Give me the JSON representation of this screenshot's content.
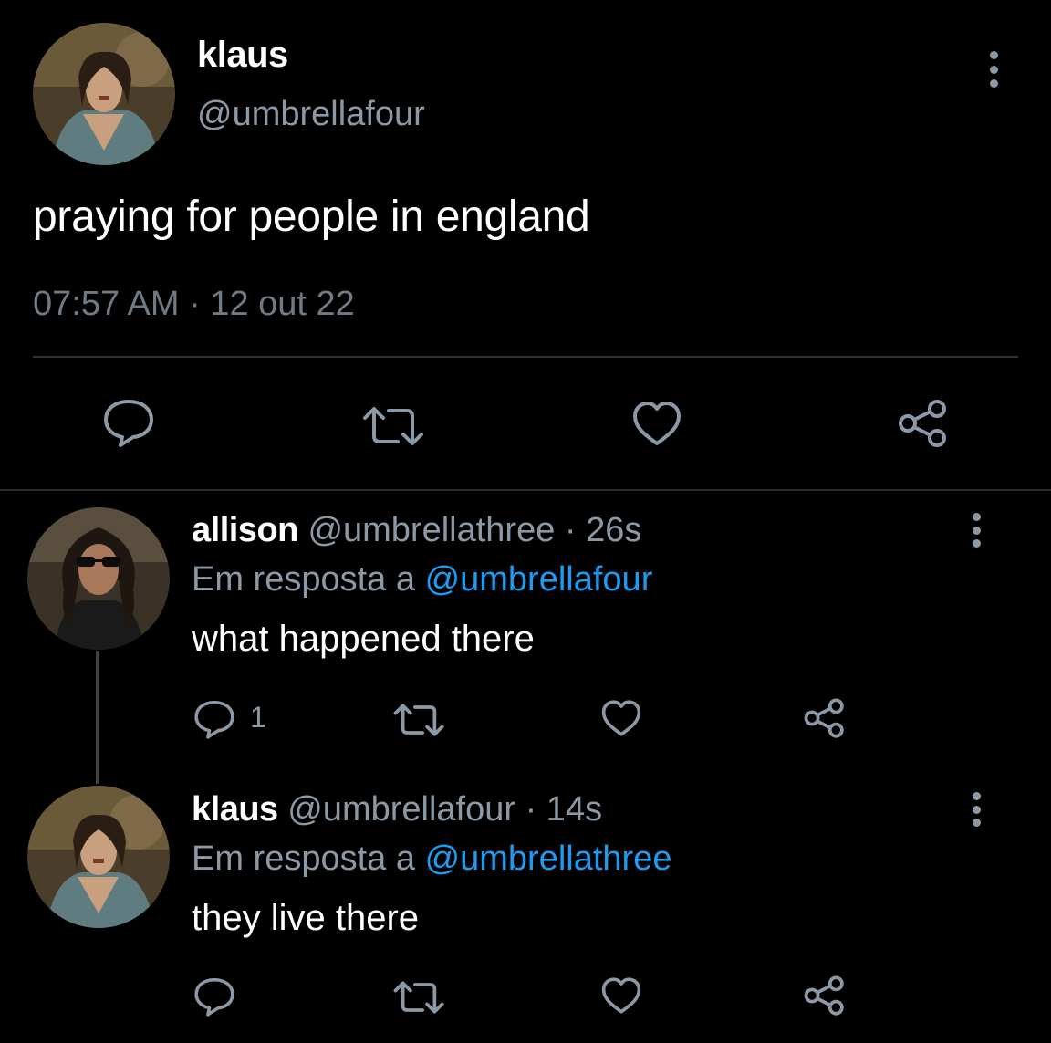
{
  "main_tweet": {
    "name": "klaus",
    "handle": "@umbrellafour",
    "text": "praying for people in england",
    "timestamp": "07:57 AM · 12 out 22",
    "more_icon": "more-vertical-icon",
    "actions": [
      "reply-icon",
      "retweet-icon",
      "like-icon",
      "share-icon"
    ]
  },
  "replies": [
    {
      "name": "allison",
      "handle": "@umbrellathree",
      "time": "· 26s",
      "reply_prefix": "Em resposta a ",
      "reply_to": "@umbrellafour",
      "text": "what happened there",
      "reply_count": "1"
    },
    {
      "name": "klaus",
      "handle": "@umbrellafour",
      "time": "· 14s",
      "reply_prefix": "Em resposta a ",
      "reply_to": "@umbrellathree",
      "text": "they live there",
      "reply_count": ""
    }
  ],
  "colors": {
    "background": "#000000",
    "text_primary": "#ffffff",
    "text_secondary": "#8b98a5",
    "link": "#1d9bf0",
    "divider": "#2f3336"
  }
}
